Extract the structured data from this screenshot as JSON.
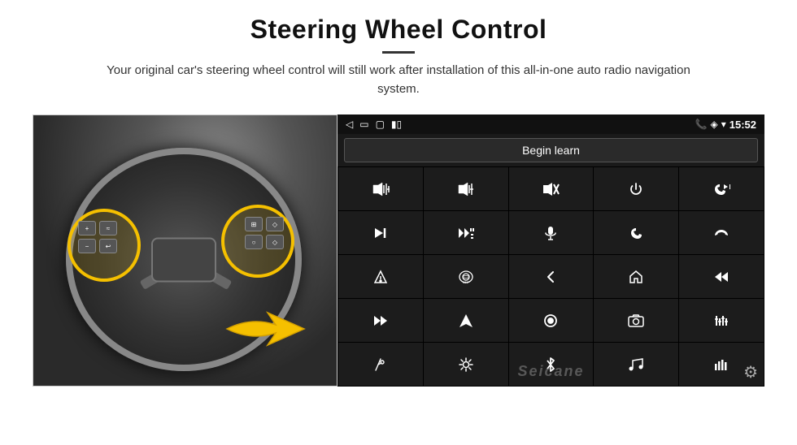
{
  "header": {
    "title": "Steering Wheel Control",
    "divider": true,
    "subtitle": "Your original car's steering wheel control will still work after installation of this all-in-one auto radio navigation system."
  },
  "status_bar": {
    "back_icon": "◁",
    "home_icon": "▭",
    "recent_icon": "▢",
    "battery_icon": "▮▯",
    "phone_icon": "📞",
    "location_icon": "◈",
    "wifi_icon": "▾",
    "time": "15:52"
  },
  "learn_button": {
    "label": "Begin learn"
  },
  "controls": [
    {
      "icon": "🔊+",
      "title": "vol-up"
    },
    {
      "icon": "🔊−",
      "title": "vol-down"
    },
    {
      "icon": "🔇",
      "title": "mute"
    },
    {
      "icon": "⏻",
      "title": "power"
    },
    {
      "icon": "📞⏮",
      "title": "phone-prev"
    },
    {
      "icon": "⏭",
      "title": "next-track"
    },
    {
      "icon": "⏯✕",
      "title": "play-skip"
    },
    {
      "icon": "🎤",
      "title": "mic"
    },
    {
      "icon": "📞",
      "title": "phone"
    },
    {
      "icon": "↩",
      "title": "hang-up"
    },
    {
      "icon": "🔔",
      "title": "alert"
    },
    {
      "icon": "360°",
      "title": "camera-360"
    },
    {
      "icon": "↺",
      "title": "back"
    },
    {
      "icon": "🏠",
      "title": "home"
    },
    {
      "icon": "⏮⏮",
      "title": "rewind"
    },
    {
      "icon": "⏭⏭",
      "title": "fast-forward"
    },
    {
      "icon": "▶",
      "title": "navigate"
    },
    {
      "icon": "⏺",
      "title": "enter"
    },
    {
      "icon": "📷",
      "title": "camera"
    },
    {
      "icon": "≡|≡",
      "title": "equalizer"
    },
    {
      "icon": "🎙",
      "title": "mic2"
    },
    {
      "icon": "⊙",
      "title": "settings2"
    },
    {
      "icon": "✱",
      "title": "bluetooth"
    },
    {
      "icon": "🎵",
      "title": "music"
    },
    {
      "icon": "📊",
      "title": "spectrum"
    }
  ],
  "watermark": "Seicane",
  "gear_icon": "⚙"
}
